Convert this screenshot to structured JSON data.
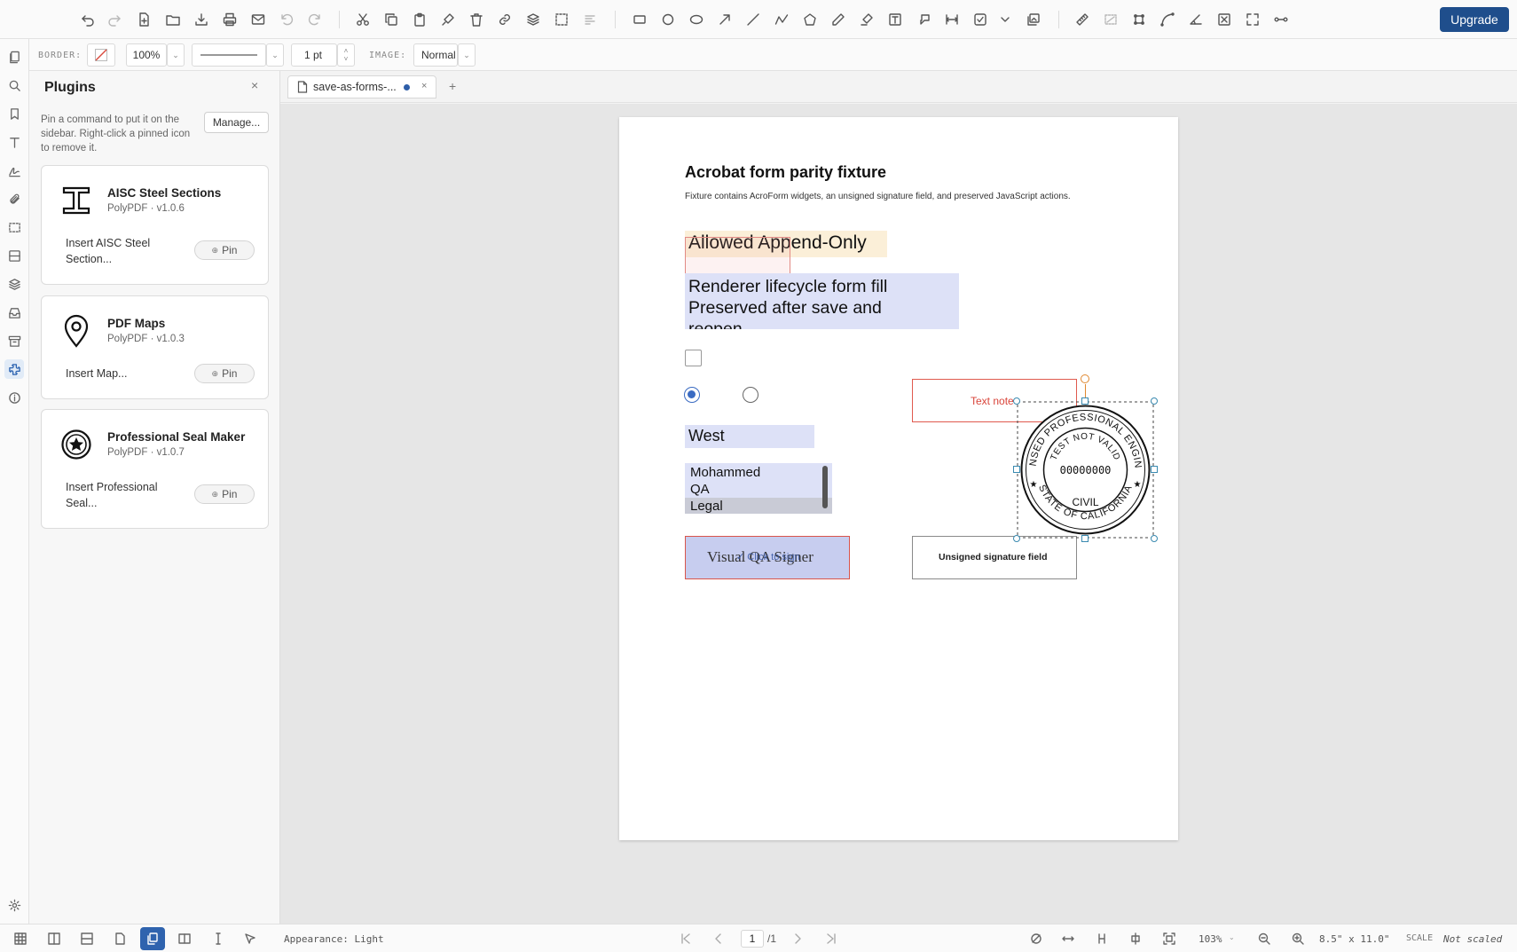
{
  "toolbar": {
    "icons": [
      "undo-icon",
      "redo-icon",
      "new-document-icon",
      "open-folder-icon",
      "download-icon",
      "print-icon",
      "email-icon",
      "rotate-left-icon",
      "rotate-right-icon",
      "cut-icon",
      "copy-icon",
      "paste-icon",
      "format-paint-icon",
      "delete-icon",
      "link-icon",
      "layers-icon",
      "select-area-icon",
      "align-icon",
      "rectangle-icon",
      "circle-icon",
      "ellipse-icon",
      "arrow-icon",
      "line-icon",
      "polyline-icon",
      "polygon-icon",
      "pen-icon",
      "highlighter-icon",
      "text-box-icon",
      "callout-icon",
      "dimension-icon",
      "checkbox-tool-icon",
      "chevron-down-icon",
      "image-stack-icon",
      "ruler-icon",
      "area-measure-icon",
      "crop-icon",
      "arc-icon",
      "angle-icon",
      "redact-icon",
      "fullscreen-icon",
      "connector-icon"
    ],
    "upgrade_label": "Upgrade"
  },
  "properties": {
    "border_label": "BORDER:",
    "opacity": "100%",
    "stroke_width": "1 pt",
    "image_label": "IMAGE:",
    "image_mode": "Normal",
    "caret": "⌄"
  },
  "sidebar_rail": [
    "pages-icon",
    "search-icon",
    "bookmark-icon",
    "text-icon",
    "signature-icon",
    "attachment-icon",
    "selection-icon",
    "forms-icon",
    "layers-icon",
    "inbox-icon",
    "archive-icon",
    "plugins-icon",
    "info-icon",
    "settings-icon"
  ],
  "plugins_panel": {
    "title": "Plugins",
    "close": "×",
    "description": "Pin a command to put it on the sidebar. Right-click a pinned icon to remove it.",
    "manage_label": "Manage...",
    "pin_label": "Pin",
    "pin_glyph": "⊕",
    "items": [
      {
        "name": "AISC Steel Sections",
        "version": "PolyPDF · v1.0.6",
        "command": "Insert AISC Steel Section...",
        "icon": "i-beam-icon"
      },
      {
        "name": "PDF Maps",
        "version": "PolyPDF · v1.0.3",
        "command": "Insert Map...",
        "icon": "map-pin-icon"
      },
      {
        "name": "Professional Seal Maker",
        "version": "PolyPDF · v1.0.7",
        "command": "Insert Professional Seal...",
        "icon": "seal-icon"
      }
    ]
  },
  "tabs": {
    "document_name": "save-as-forms-...",
    "close": "×",
    "add": "+"
  },
  "document": {
    "title": "Acrobat form parity fixture",
    "subtitle": "Fixture contains AcroForm widgets, an unsigned signature field, and preserved JavaScript actions.",
    "append_only_field": "Allowed Append-Only",
    "multiline_field": "Renderer lifecycle form fill\nPreserved after save and\nreopen",
    "radio_selected": 0,
    "dropdown_value": "West",
    "listbox_options": [
      "Mohammed",
      "QA",
      "Legal"
    ],
    "listbox_selected": "Legal",
    "signer_text": "Visual QA Signer",
    "signer_overlay": "✓ Click to sign",
    "text_note": "Text note",
    "unsigned_field": "Unsigned signature field",
    "seal": {
      "top_text": "LICENSED PROFESSIONAL ENGINEER",
      "bottom_text": "STATE OF CALIFORNIA",
      "inner_top": "TEST NOT VALID",
      "number": "00000000",
      "discipline": "CIVIL",
      "stars": "★"
    },
    "badge_colors": {
      "accent": "#3a6bc2",
      "note_red": "#e05a4e",
      "handle": "#3a8ab0"
    }
  },
  "status": {
    "appearance": "Appearance: Light",
    "page_current": "1",
    "page_total": "/1",
    "zoom": "103%",
    "page_size": "8.5\" x 11.0\"",
    "scale_label": "SCALE",
    "scale_value": "Not scaled"
  }
}
